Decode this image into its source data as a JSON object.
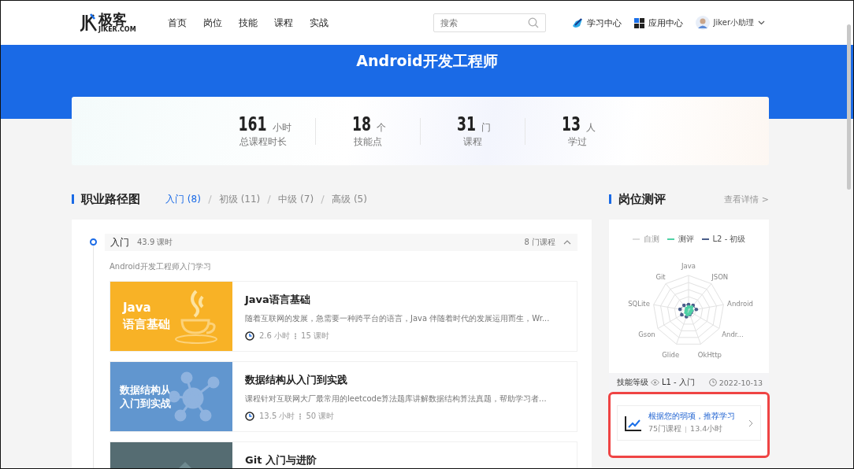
{
  "header": {
    "logo_text": "极客",
    "logo_sub": "JIKER.COM",
    "nav": [
      {
        "label": "首页"
      },
      {
        "label": "岗位"
      },
      {
        "label": "技能"
      },
      {
        "label": "课程"
      },
      {
        "label": "实战"
      }
    ],
    "search": {
      "placeholder": "搜索"
    },
    "links": [
      {
        "kind": "learn",
        "label": "学习中心"
      },
      {
        "kind": "apps",
        "label": "应用中心"
      }
    ],
    "user": "Jiker小助理"
  },
  "banner": {
    "title": "Android开发工程师"
  },
  "stats": [
    {
      "value": "161",
      "unit": "小时",
      "label": "总课程时长"
    },
    {
      "value": "18",
      "unit": "个",
      "label": "技能点"
    },
    {
      "value": "31",
      "unit": "门",
      "label": "课程"
    },
    {
      "value": "13",
      "unit": "人",
      "label": "学过"
    }
  ],
  "path": {
    "title": "职业路径图",
    "tabs": [
      {
        "label": "入门 (8)",
        "selected": true
      },
      {
        "label": "初级 (11)",
        "selected": false
      },
      {
        "label": "中级 (7)",
        "selected": false
      },
      {
        "label": "高级 (5)",
        "selected": false
      }
    ],
    "stage": {
      "name": "入门",
      "hours": "43.9 课时",
      "count": "8 门课程",
      "expanded": true,
      "description": "Android开发工程师入门学习"
    },
    "courses": [
      {
        "kind": "java",
        "thumb_text": [
          "Java",
          "语言基础"
        ],
        "title": "Java语言基础",
        "description": "随着互联网的发展，急需要一种跨平台的语言，Java 伴随着时代的发展运用而生，Wr...",
        "hours": "2.6 小时",
        "lessons": "15 课时"
      },
      {
        "kind": "data",
        "thumb_text": [
          "数据结构从",
          "入门到实战"
        ],
        "title": "数据结构从入门到实践",
        "description": "课程针对互联网大厂最常用的leetcode算法题库讲解数据结构算法真题，帮助学习者...",
        "hours": "13.5 小时",
        "lessons": "50 课时"
      },
      {
        "kind": "git",
        "title": "Git 入门与进阶"
      }
    ]
  },
  "assessment": {
    "title": "岗位测评",
    "more": "查看详情 >",
    "legend": [
      {
        "label": "自测",
        "color": "#dddddd"
      },
      {
        "label": "测评",
        "color": "#4fd1a5"
      },
      {
        "label": "L2 - 初级",
        "color": "#4a5d8a"
      }
    ],
    "axes": [
      "Java",
      "JSON",
      "Android",
      "Andr...",
      "OkHttp",
      "Glide",
      "Gson",
      "SQLite",
      "Git"
    ],
    "level_label": "技能等级",
    "level": "L1 - 入门",
    "date": "2022-10-13",
    "recommend": {
      "title": "根据您的弱项，推荐学习",
      "courses": "75门课程",
      "hours": "13.4小时"
    }
  }
}
